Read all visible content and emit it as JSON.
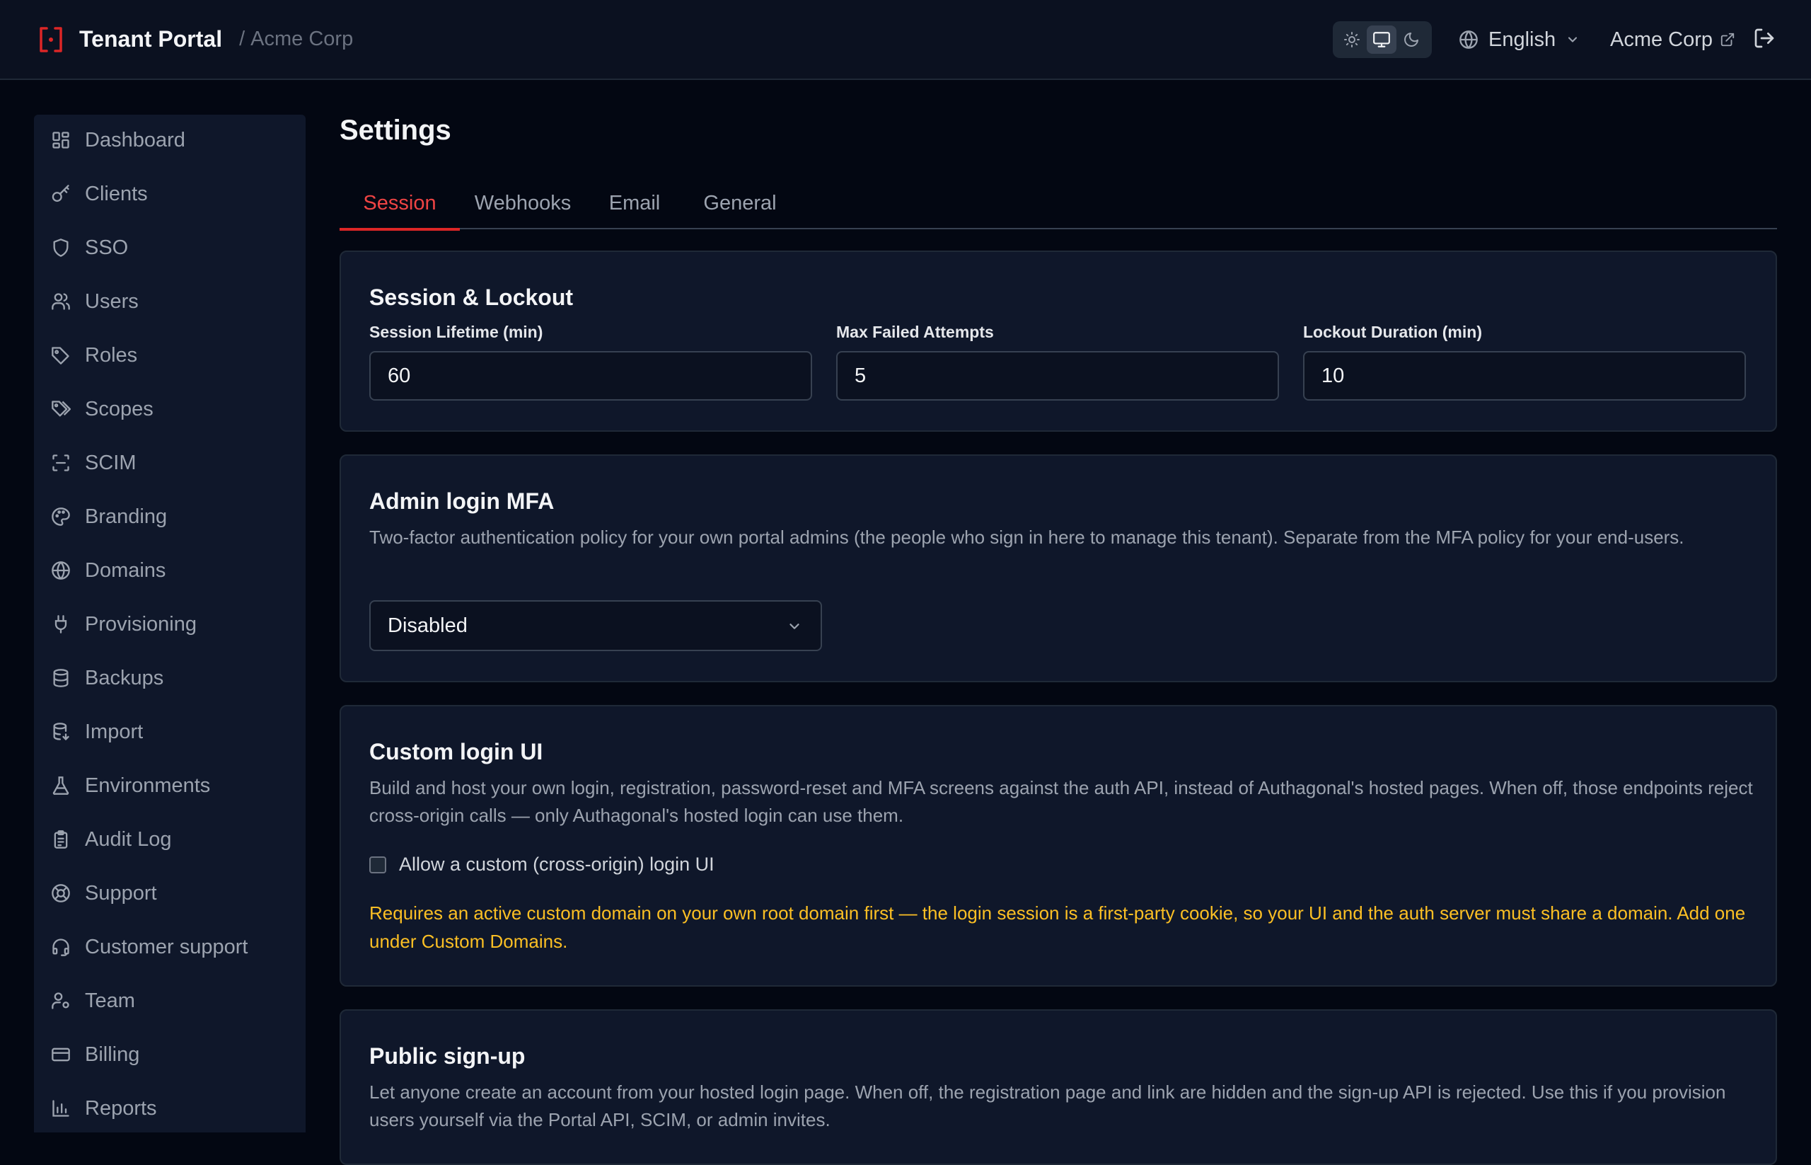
{
  "header": {
    "title": "Tenant Portal",
    "separator": "/",
    "tenant": "Acme Corp",
    "language": "English",
    "tenant_link": "Acme Corp"
  },
  "sidebar": {
    "items": [
      {
        "label": "Dashboard",
        "icon": "dashboard-icon"
      },
      {
        "label": "Clients",
        "icon": "key-icon"
      },
      {
        "label": "SSO",
        "icon": "shield-icon"
      },
      {
        "label": "Users",
        "icon": "users-icon"
      },
      {
        "label": "Roles",
        "icon": "tag-icon"
      },
      {
        "label": "Scopes",
        "icon": "tags-icon"
      },
      {
        "label": "SCIM",
        "icon": "scan-icon"
      },
      {
        "label": "Branding",
        "icon": "palette-icon"
      },
      {
        "label": "Domains",
        "icon": "globe-icon"
      },
      {
        "label": "Provisioning",
        "icon": "plug-icon"
      },
      {
        "label": "Backups",
        "icon": "database-icon"
      },
      {
        "label": "Import",
        "icon": "database-import-icon"
      },
      {
        "label": "Environments",
        "icon": "flask-icon"
      },
      {
        "label": "Audit Log",
        "icon": "clipboard-icon"
      },
      {
        "label": "Support",
        "icon": "lifebuoy-icon"
      },
      {
        "label": "Customer support",
        "icon": "headset-icon"
      },
      {
        "label": "Team",
        "icon": "user-cog-icon"
      },
      {
        "label": "Billing",
        "icon": "credit-card-icon"
      },
      {
        "label": "Reports",
        "icon": "bar-chart-icon"
      }
    ]
  },
  "main": {
    "title": "Settings",
    "tabs": [
      {
        "label": "Session",
        "active": true
      },
      {
        "label": "Webhooks",
        "active": false
      },
      {
        "label": "Email",
        "active": false
      },
      {
        "label": "General",
        "active": false
      }
    ],
    "session": {
      "title": "Session & Lockout",
      "fields": [
        {
          "label": "Session Lifetime (min)",
          "value": "60"
        },
        {
          "label": "Max Failed Attempts",
          "value": "5"
        },
        {
          "label": "Lockout Duration (min)",
          "value": "10"
        }
      ]
    },
    "mfa": {
      "title": "Admin login MFA",
      "description": "Two-factor authentication policy for your own portal admins (the people who sign in here to manage this tenant). Separate from the MFA policy for your end-users.",
      "selected": "Disabled"
    },
    "custom_login": {
      "title": "Custom login UI",
      "description": "Build and host your own login, registration, password-reset and MFA screens against the auth API, instead of Authagonal's hosted pages. When off, those endpoints reject cross-origin calls — only Authagonal's hosted login can use them.",
      "checkbox_label": "Allow a custom (cross-origin) login UI",
      "checked": false,
      "warning": "Requires an active custom domain on your own root domain first — the login session is a first-party cookie, so your UI and the auth server must share a domain. Add one under Custom Domains."
    },
    "signup": {
      "title": "Public sign-up",
      "description": "Let anyone create an account from your hosted login page. When off, the registration page and link are hidden and the sign-up API is rejected. Use this if you provision users yourself via the Portal API, SCIM, or admin invites."
    }
  },
  "colors": {
    "accent": "#dc2626",
    "background": "#030712",
    "card": "#0f172a",
    "warning": "#fbbf24"
  }
}
